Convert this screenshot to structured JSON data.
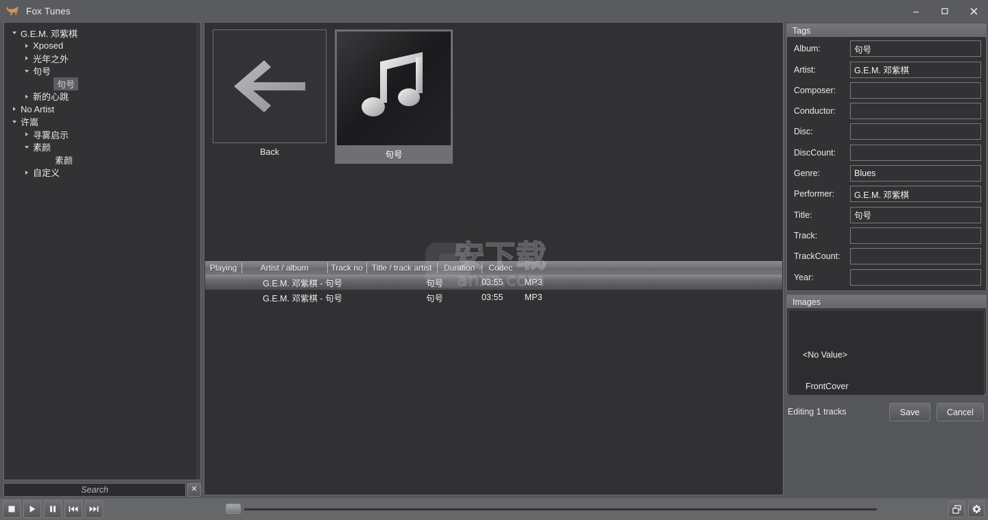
{
  "window": {
    "title": "Fox Tunes",
    "icon": "fox-icon",
    "controls": {
      "minimize": "minimize-icon",
      "maximize": "maximize-icon",
      "close": "close-icon"
    }
  },
  "sidebar": {
    "tree": [
      {
        "label": "G.E.M. 邓紫棋",
        "depth": 0,
        "state": "expanded",
        "selected": false
      },
      {
        "label": "Xposed",
        "depth": 1,
        "state": "collapsed",
        "selected": false
      },
      {
        "label": "光年之外",
        "depth": 1,
        "state": "collapsed",
        "selected": false
      },
      {
        "label": "句号",
        "depth": 1,
        "state": "expanded",
        "selected": false
      },
      {
        "label": "句号",
        "depth": 2,
        "state": "leaf",
        "selected": true
      },
      {
        "label": "新的心跳",
        "depth": 1,
        "state": "collapsed",
        "selected": false
      },
      {
        "label": "No Artist",
        "depth": 0,
        "state": "collapsed",
        "selected": false
      },
      {
        "label": "许嵩",
        "depth": 0,
        "state": "expanded",
        "selected": false
      },
      {
        "label": "寻雾启示",
        "depth": 1,
        "state": "collapsed",
        "selected": false
      },
      {
        "label": "素颜",
        "depth": 1,
        "state": "expanded",
        "selected": false
      },
      {
        "label": "素颜",
        "depth": 2,
        "state": "leaf",
        "selected": false
      },
      {
        "label": "自定义",
        "depth": 1,
        "state": "collapsed",
        "selected": false
      }
    ]
  },
  "search": {
    "value": "",
    "placeholder": "Search",
    "clear_label": "✕"
  },
  "transport": {
    "buttons": [
      {
        "name": "stop-button",
        "icon": "stop-icon"
      },
      {
        "name": "play-button",
        "icon": "play-icon"
      },
      {
        "name": "pause-button",
        "icon": "pause-icon"
      },
      {
        "name": "previous-button",
        "icon": "previous-track-icon"
      },
      {
        "name": "next-button",
        "icon": "next-track-icon"
      }
    ],
    "seek_position_percent": 0,
    "right_buttons": [
      {
        "name": "windows-button",
        "icon": "windows-restore-icon"
      },
      {
        "name": "settings-button",
        "icon": "gear-icon"
      }
    ]
  },
  "browser": {
    "items": [
      {
        "type": "back",
        "caption": "Back",
        "icon": "back-arrow-icon"
      },
      {
        "type": "album",
        "caption": "句号",
        "icon": "music-note-icon"
      }
    ]
  },
  "tracklist": {
    "columns": [
      "Playing",
      "Artist / album",
      "Track no",
      "Title / track artist",
      "Duration",
      "Codec"
    ],
    "rows": [
      {
        "playing": "",
        "artist": "G.E.M. 邓紫棋 - 句号",
        "trackno": "",
        "title": "句号",
        "duration": "03:55",
        "codec": "MP3",
        "selected": true
      },
      {
        "playing": "",
        "artist": "G.E.M. 邓紫棋 - 句号",
        "trackno": "",
        "title": "句号",
        "duration": "03:55",
        "codec": "MP3",
        "selected": false
      }
    ]
  },
  "tags": {
    "header": "Tags",
    "fields": [
      {
        "label": "Album:",
        "value": "句号"
      },
      {
        "label": "Artist:",
        "value": "G.E.M. 邓紫棋"
      },
      {
        "label": "Composer:",
        "value": ""
      },
      {
        "label": "Conductor:",
        "value": ""
      },
      {
        "label": "Disc:",
        "value": ""
      },
      {
        "label": "DiscCount:",
        "value": ""
      },
      {
        "label": "Genre:",
        "value": "Blues"
      },
      {
        "label": "Performer:",
        "value": "G.E.M. 邓紫棋"
      },
      {
        "label": "Title:",
        "value": "句号"
      },
      {
        "label": "Track:",
        "value": ""
      },
      {
        "label": "TrackCount:",
        "value": ""
      },
      {
        "label": "Year:",
        "value": ""
      }
    ]
  },
  "images": {
    "header": "Images",
    "no_value": "<No Value>",
    "caption": "FrontCover"
  },
  "editbar": {
    "status": "Editing 1 tracks",
    "save_label": "Save",
    "cancel_label": "Cancel"
  },
  "watermark": {
    "main": "安下载",
    "sub": "anxz.com"
  },
  "colors": {
    "chrome": "#5a5b5e",
    "panel_bg": "#323234",
    "panel_border": "#6b6c6f",
    "text": "#ededee",
    "selection": "#5d5e62",
    "transport_bg": "#666769"
  }
}
